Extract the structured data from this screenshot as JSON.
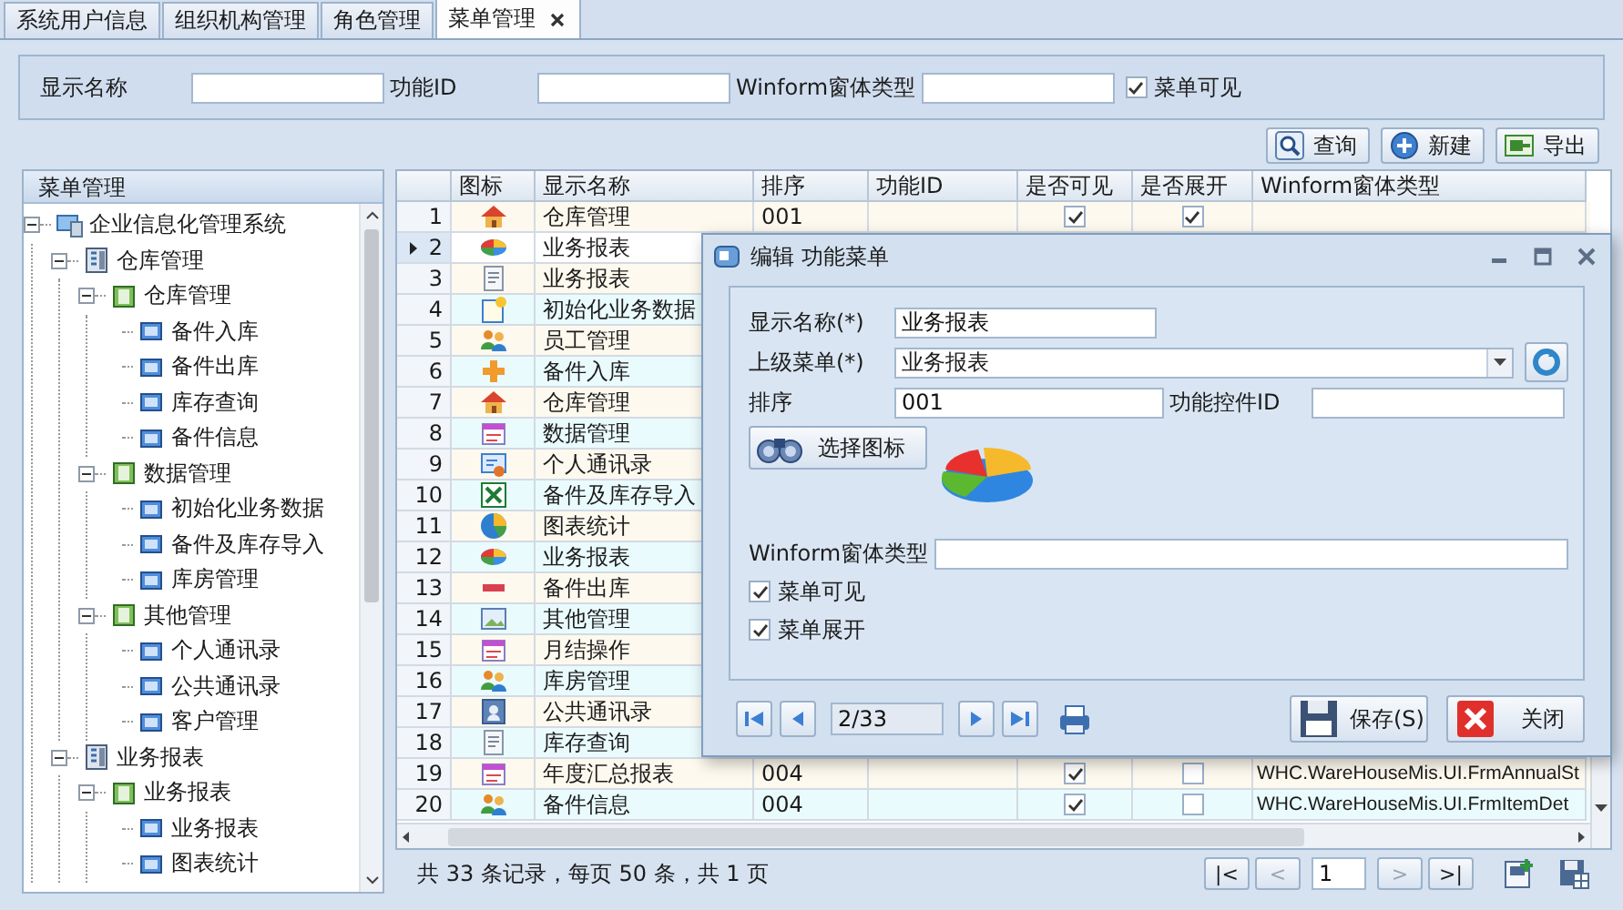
{
  "tabs": [
    {
      "label": "系统用户信息",
      "selected": false
    },
    {
      "label": "组织机构管理",
      "selected": false
    },
    {
      "label": "角色管理",
      "selected": false
    },
    {
      "label": "菜单管理",
      "selected": true
    }
  ],
  "search": {
    "fields": [
      {
        "label": "显示名称"
      },
      {
        "label": "功能ID"
      },
      {
        "label": "Winform窗体类型"
      }
    ],
    "checkbox": {
      "label": "菜单可见",
      "checked": true
    }
  },
  "toolbar": {
    "buttons": [
      {
        "label": "查询",
        "kind": "search"
      },
      {
        "label": "新建",
        "kind": "add"
      },
      {
        "label": "导出",
        "kind": "export"
      }
    ]
  },
  "tree": {
    "title": "菜单管理",
    "items": [
      {
        "label": "企业信息化管理系统",
        "expanded": true,
        "children": [
          {
            "label": "仓库管理",
            "expanded": true,
            "children": [
              {
                "label": "仓库管理",
                "expanded": true,
                "children": [
                  {
                    "label": "备件入库"
                  },
                  {
                    "label": "备件出库"
                  },
                  {
                    "label": "库存查询"
                  },
                  {
                    "label": "备件信息"
                  }
                ]
              },
              {
                "label": "数据管理",
                "expanded": true,
                "children": [
                  {
                    "label": "初始化业务数据"
                  },
                  {
                    "label": "备件及库存导入"
                  },
                  {
                    "label": "库房管理"
                  }
                ]
              },
              {
                "label": "其他管理",
                "expanded": true,
                "children": [
                  {
                    "label": "个人通讯录"
                  },
                  {
                    "label": "公共通讯录"
                  },
                  {
                    "label": "客户管理"
                  }
                ]
              }
            ]
          },
          {
            "label": "业务报表",
            "expanded": true,
            "children": [
              {
                "label": "业务报表",
                "expanded": true,
                "children": [
                  {
                    "label": "业务报表"
                  },
                  {
                    "label": "图表统计"
                  }
                ]
              }
            ]
          }
        ]
      }
    ]
  },
  "grid": {
    "columns": [
      "图标",
      "显示名称",
      "排序",
      "功能ID",
      "是否可见",
      "是否展开",
      "Winform窗体类型"
    ],
    "rows": [
      {
        "number": "1",
        "name": "仓库管理",
        "order": "001",
        "visible": true,
        "expanded": true,
        "selected": false
      },
      {
        "number": "2",
        "name": "业务报表",
        "selected": true
      },
      {
        "number": "3",
        "name": "业务报表",
        "selected": false
      },
      {
        "number": "4",
        "name": "初始化业务数据",
        "selected": false
      },
      {
        "number": "5",
        "name": "员工管理",
        "selected": false
      },
      {
        "number": "6",
        "name": "备件入库",
        "selected": false
      },
      {
        "number": "7",
        "name": "仓库管理",
        "selected": false
      },
      {
        "number": "8",
        "name": "数据管理",
        "selected": false
      },
      {
        "number": "9",
        "name": "个人通讯录",
        "selected": false
      },
      {
        "number": "10",
        "name": "备件及库存导入",
        "selected": false
      },
      {
        "number": "11",
        "name": "图表统计",
        "selected": false
      },
      {
        "number": "12",
        "name": "业务报表",
        "selected": false
      },
      {
        "number": "13",
        "name": "备件出库",
        "selected": false
      },
      {
        "number": "14",
        "name": "其他管理",
        "selected": false
      },
      {
        "number": "15",
        "name": "月结操作",
        "selected": false
      },
      {
        "number": "16",
        "name": "库房管理",
        "selected": false
      },
      {
        "number": "17",
        "name": "公共通讯录",
        "selected": false
      },
      {
        "number": "18",
        "name": "库存查询",
        "selected": false
      },
      {
        "number": "19",
        "name": "年度汇总报表",
        "order": "004",
        "visible": true,
        "expanded": false,
        "winform": "WHC.WareHouseMis.UI.FrmAnnualSt",
        "selected": false
      },
      {
        "number": "20",
        "name": "备件信息",
        "order": "004",
        "visible": true,
        "expanded": false,
        "winform": "WHC.WareHouseMis.UI.FrmItemDet",
        "selected": false
      }
    ]
  },
  "status_bar": {
    "text": "共 33 条记录，每页 50 条，共 1 页",
    "page": "1",
    "pager": [
      {
        "label": "|<",
        "disabled": false
      },
      {
        "label": "<",
        "disabled": true
      },
      {
        "label": ">",
        "disabled": true
      },
      {
        "label": ">|",
        "disabled": false
      }
    ]
  },
  "dialog": {
    "title": "编辑 功能菜单",
    "name": {
      "label": "显示名称(*)",
      "value": "业务报表"
    },
    "parent": {
      "label": "上级菜单(*)",
      "value": "业务报表"
    },
    "order": {
      "label": "排序",
      "value": "001"
    },
    "control_id": {
      "label": "功能控件ID"
    },
    "icon_button": "选择图标",
    "winform": {
      "label": "Winform窗体类型"
    },
    "checkboxes": [
      {
        "label": "菜单可见",
        "checked": true
      },
      {
        "label": "菜单展开",
        "checked": true
      }
    ],
    "record": "2/33",
    "save": "保存(S)",
    "close": "关闭"
  }
}
